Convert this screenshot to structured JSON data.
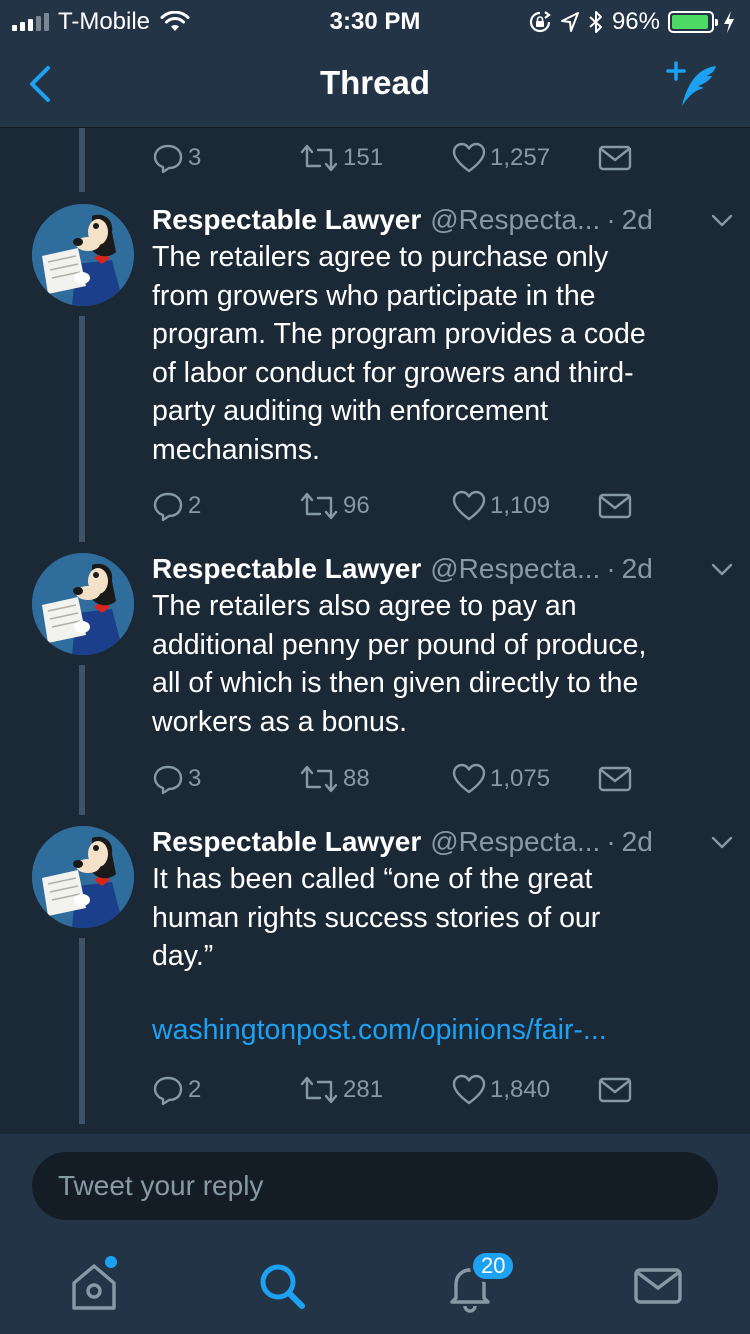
{
  "status_bar": {
    "carrier": "T-Mobile",
    "time": "3:30 PM",
    "battery": "96%",
    "battery_level": 0.96,
    "signal_bars_on": 3,
    "signal_bars_total": 5
  },
  "nav": {
    "title": "Thread",
    "back_icon": "chevron-left-icon",
    "compose_icon": "compose-tweet-icon"
  },
  "previous_tweet_actions": {
    "replies": "3",
    "retweets": "151",
    "likes": "1,257"
  },
  "tweets": [
    {
      "name": "Respectable Lawyer",
      "handle": "@Respecta...",
      "separator": "·",
      "time": "2d",
      "text": "The retailers agree to purchase only\nfrom growers who participate in the\nprogram. The program provides a code\nof labor conduct for growers and third-\nparty auditing with enforcement\nmechanisms.",
      "replies": "2",
      "retweets": "96",
      "likes": "1,109"
    },
    {
      "name": "Respectable Lawyer",
      "handle": "@Respecta...",
      "separator": "·",
      "time": "2d",
      "text": "The retailers also agree to pay an\nadditional penny per pound of produce,\nall of which is then given directly to the\nworkers as a bonus.",
      "replies": "3",
      "retweets": "88",
      "likes": "1,075"
    },
    {
      "name": "Respectable Lawyer",
      "handle": "@Respecta...",
      "separator": "·",
      "time": "2d",
      "text": "It has been called “one of the great\nhuman rights success stories of our\nday.”",
      "link": "washingtonpost.com/opinions/fair-...",
      "replies": "2",
      "retweets": "281",
      "likes": "1,840"
    }
  ],
  "reply_bar": {
    "placeholder": "Tweet your reply"
  },
  "tab_bar": {
    "notifications_badge": "20",
    "active_tab": "search"
  },
  "colors": {
    "background": "#1b2836",
    "bar_background": "#243447",
    "accent": "#1da1f2",
    "secondary_text": "#8899a6",
    "battery_green": "#4cd964"
  }
}
